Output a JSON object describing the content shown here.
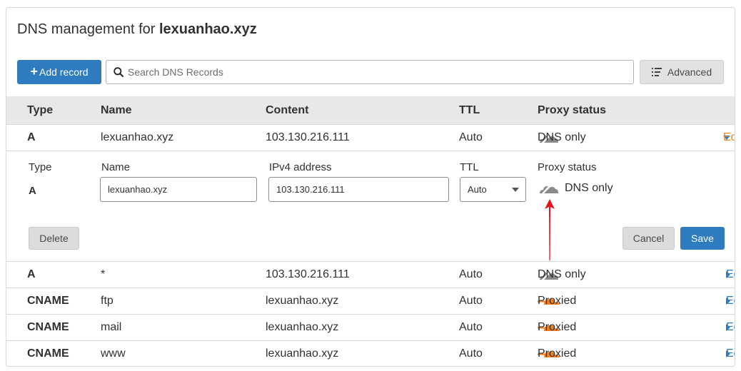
{
  "header": {
    "title_prefix": "DNS management for ",
    "domain": "lexuanhao.xyz"
  },
  "toolbar": {
    "add_label": "Add record",
    "add_icon": "plus-icon",
    "search_placeholder": "Search DNS Records",
    "advanced_label": "Advanced"
  },
  "table": {
    "headers": {
      "type": "Type",
      "name": "Name",
      "content": "Content",
      "ttl": "TTL",
      "proxy": "Proxy status"
    },
    "rows": [
      {
        "type": "A",
        "name": "lexuanhao.xyz",
        "content": "103.130.216.111",
        "ttl": "Auto",
        "proxy": "DNS only",
        "edit": "Edit"
      },
      {
        "type": "A",
        "name": "*",
        "content": "103.130.216.111",
        "ttl": "Auto",
        "proxy": "DNS only",
        "edit": "Edit"
      },
      {
        "type": "CNAME",
        "name": "ftp",
        "content": "lexuanhao.xyz",
        "ttl": "Auto",
        "proxy": "Proxied",
        "edit": "Edit"
      },
      {
        "type": "CNAME",
        "name": "mail",
        "content": "lexuanhao.xyz",
        "ttl": "Auto",
        "proxy": "Proxied",
        "edit": "Edit"
      },
      {
        "type": "CNAME",
        "name": "www",
        "content": "lexuanhao.xyz",
        "ttl": "Auto",
        "proxy": "Proxied",
        "edit": "Edit"
      }
    ]
  },
  "editor": {
    "labels": {
      "type": "Type",
      "name": "Name",
      "content": "IPv4 address",
      "ttl": "TTL",
      "proxy": "Proxy status"
    },
    "type_value": "A",
    "name_value": "lexuanhao.xyz",
    "ip_value": "103.130.216.111",
    "ttl_value": "Auto",
    "proxy_value": "DNS only",
    "delete_label": "Delete",
    "cancel_label": "Cancel",
    "save_label": "Save"
  },
  "colors": {
    "accent": "#2f7bbf",
    "proxied": "#f38020",
    "dns_only": "#8a8a8a",
    "annotation": "#e8121b"
  }
}
